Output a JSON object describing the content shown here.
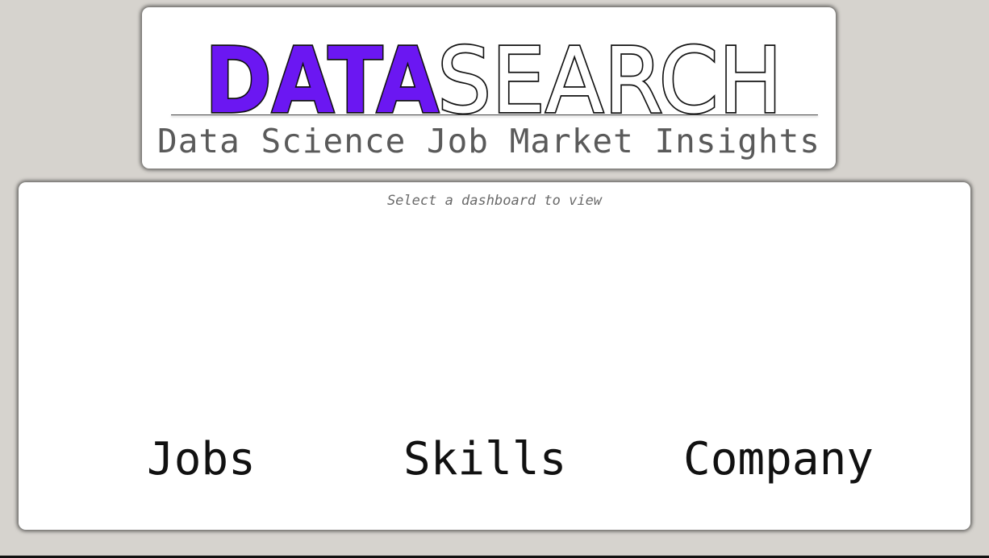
{
  "header": {
    "logo_part_1": "DATA",
    "logo_part_2": "SEARCH",
    "tagline": "Data Science Job Market Insights"
  },
  "main": {
    "prompt": "Select a dashboard to view",
    "nav_items": [
      {
        "label": "Jobs"
      },
      {
        "label": "Skills"
      },
      {
        "label": "Company"
      }
    ]
  },
  "colors": {
    "background": "#d6d3ce",
    "card": "#ffffff",
    "logo_accent": "#6b17f2",
    "logo_outline": "#111111",
    "tagline": "#5a5a5a",
    "prompt": "#6a6a6a"
  }
}
